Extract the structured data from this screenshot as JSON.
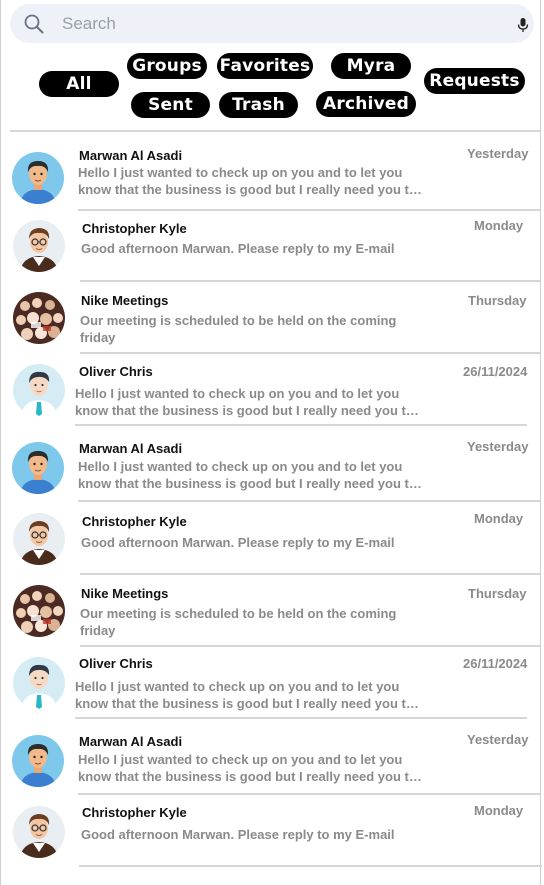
{
  "search": {
    "placeholder": "Search"
  },
  "filters": {
    "all": "All",
    "groups": "Groups",
    "favorites": "Favorites",
    "myra": "Myra",
    "requests": "Requests",
    "sent": "Sent",
    "trash": "Trash",
    "archived": "Archived"
  },
  "messages": [
    {
      "name": "Marwan Al Asadi",
      "date": "Yesterday",
      "preview": "Hello I just wanted to check up on you and to let you know that the business is  good but I really need you to check in",
      "avatar": "man-blue-avatar"
    },
    {
      "name": "Christopher Kyle",
      "date": "Monday",
      "preview": "Good afternoon Marwan. Please reply to my E-mail",
      "avatar": "man-glasses-avatar"
    },
    {
      "name": "Nike Meetings",
      "date": "Thursday",
      "preview": "Our meeting is scheduled to be held on the coming friday",
      "avatar": "group-photo-avatar"
    },
    {
      "name": "Oliver Chris",
      "date": "26/11/2024",
      "preview": "Hello I just wanted to check up on you and to let you know that the business is  good but I really need you to check in",
      "avatar": "man-tie-avatar"
    },
    {
      "name": "Marwan Al Asadi",
      "date": "Yesterday",
      "preview": "Hello I just wanted to check up on you and to let you know that the business is  good but I really need you to check in",
      "avatar": "man-blue-avatar"
    },
    {
      "name": "Christopher Kyle",
      "date": "Monday",
      "preview": "Good afternoon Marwan. Please reply to my E-mail",
      "avatar": "man-glasses-avatar"
    },
    {
      "name": "Nike Meetings",
      "date": "Thursday",
      "preview": "Our meeting is scheduled to be held on the coming friday",
      "avatar": "group-photo-avatar"
    },
    {
      "name": "Oliver Chris",
      "date": "26/11/2024",
      "preview": "Hello I just wanted to check up on you and to let you know that the business is  good but I really need you to check in",
      "avatar": "man-tie-avatar"
    },
    {
      "name": "Marwan Al Asadi",
      "date": "Yesterday",
      "preview": "Hello I just wanted to check up on you and to let you know that the business is  good but I really need you to check in",
      "avatar": "man-blue-avatar"
    },
    {
      "name": "Christopher Kyle",
      "date": "Monday",
      "preview": "Good afternoon Marwan. Please reply to my E-mail",
      "avatar": "man-glasses-avatar"
    }
  ],
  "colors": {
    "chip_bg": "#000000",
    "chip_text": "#ffffff",
    "search_bg": "#eef1f8",
    "muted_text": "#8a8a8a"
  }
}
